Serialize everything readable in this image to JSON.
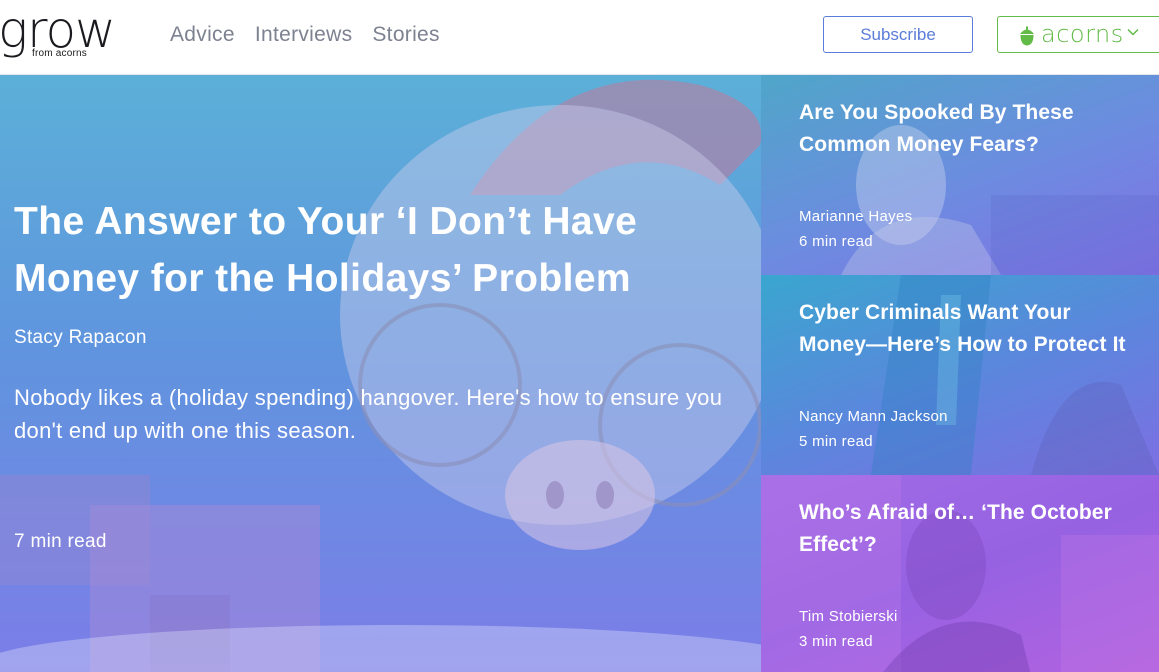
{
  "brand": {
    "logo_word": "grow",
    "logo_sub": "from acorns"
  },
  "nav": {
    "items": [
      {
        "label": "Advice"
      },
      {
        "label": "Interviews"
      },
      {
        "label": "Stories"
      }
    ]
  },
  "header_actions": {
    "subscribe_label": "Subscribe",
    "acorns_label": "acorns",
    "acorns_icon": "acorn-icon",
    "dropdown_icon": "chevron-down-icon"
  },
  "hero": {
    "title": "The Answer to Your ‘I Don’t Have Money for the Holidays’ Problem",
    "author": "Stacy Rapacon",
    "dek": "Nobody likes a (holiday spending) hangover. Here's how to ensure you don't end up with one this season.",
    "read_time": "7 min read"
  },
  "side_articles": [
    {
      "title": "Are You Spooked By These Common Money Fears?",
      "author": "Marianne Hayes",
      "read_time": "6 min read"
    },
    {
      "title": "Cyber Criminals Want Your Money—Here’s How to Protect It",
      "author": "Nancy Mann Jackson",
      "read_time": "5 min read"
    },
    {
      "title": "Who’s Afraid of… ‘The October Effect’?",
      "author": "Tim Stobierski",
      "read_time": "3 min read"
    }
  ],
  "colors": {
    "nav_text": "#7d8290",
    "subscribe_blue": "#5b7cd9",
    "acorns_green": "#62bb47",
    "overlay_blue": "#6a8fe0",
    "overlay_purple": "#9662e2"
  }
}
